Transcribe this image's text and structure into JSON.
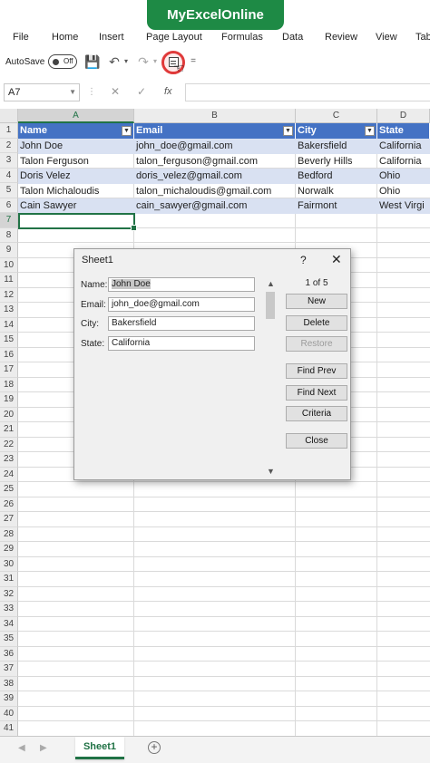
{
  "banner": {
    "title": "MyExcelOnline"
  },
  "menu": [
    "File",
    "Home",
    "Insert",
    "Page Layout",
    "Formulas",
    "Data",
    "Review",
    "View",
    "Tab"
  ],
  "qat": {
    "autosave_label": "AutoSave",
    "autosave_state": "Off",
    "more": "="
  },
  "formula_bar": {
    "name_box": "A7",
    "fx": "fx",
    "value": ""
  },
  "columns": [
    "A",
    "B",
    "C",
    "D"
  ],
  "rows": [
    "1",
    "2",
    "3",
    "4",
    "5",
    "6",
    "7",
    "8",
    "9",
    "10",
    "11",
    "12",
    "13",
    "14",
    "15",
    "16",
    "17",
    "18",
    "19",
    "20",
    "21",
    "22",
    "23",
    "24",
    "25",
    "26",
    "27",
    "28",
    "29",
    "30",
    "31",
    "32",
    "33",
    "34",
    "35",
    "36",
    "37",
    "38",
    "39",
    "40",
    "41"
  ],
  "table": {
    "headers": [
      "Name",
      "Email",
      "City",
      "State"
    ],
    "rows": [
      [
        "John Doe",
        "john_doe@gmail.com",
        "Bakersfield",
        "California"
      ],
      [
        "Talon Ferguson",
        "talon_ferguson@gmail.com",
        "Beverly Hills",
        "California"
      ],
      [
        "Doris Velez",
        "doris_velez@gmail.com",
        "Bedford",
        "Ohio"
      ],
      [
        "Talon Michaloudis",
        "talon_michaloudis@gmail.com",
        "Norwalk",
        "Ohio"
      ],
      [
        "Cain Sawyer",
        "cain_sawyer@gmail.com",
        "Fairmont",
        "West Virgi"
      ]
    ],
    "band_color": "#d9e1f2",
    "header_color": "#4472c4"
  },
  "dialog": {
    "title": "Sheet1",
    "help": "?",
    "close": "✕",
    "record": "1 of 5",
    "fields": [
      {
        "label": "Name:",
        "value": "John Doe"
      },
      {
        "label": "Email:",
        "value": "john_doe@gmail.com"
      },
      {
        "label": "City:",
        "value": "Bakersfield"
      },
      {
        "label": "State:",
        "value": "California"
      }
    ],
    "buttons": {
      "new": "New",
      "delete": "Delete",
      "restore": "Restore",
      "find_prev": "Find Prev",
      "find_next": "Find Next",
      "criteria": "Criteria",
      "close": "Close"
    }
  },
  "sheet_tab": "Sheet1",
  "accent": "#217346"
}
